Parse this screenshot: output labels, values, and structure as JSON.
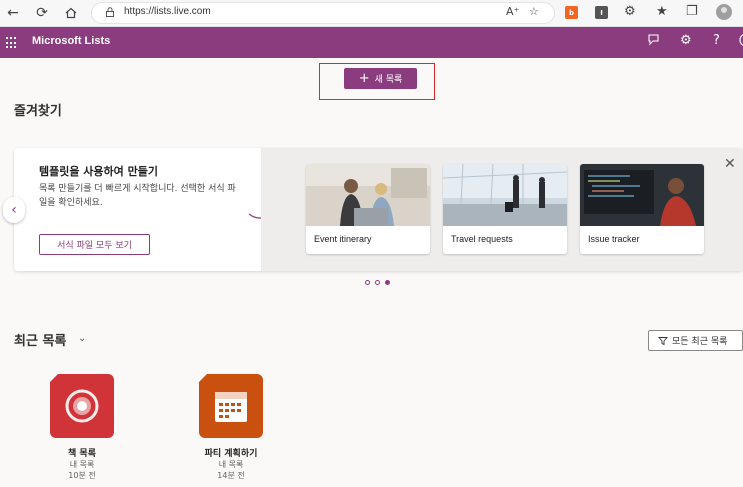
{
  "browser": {
    "url": "https://lists.live.com",
    "extension_colors": [
      "#f26522",
      "#555555"
    ]
  },
  "app": {
    "title": "Microsoft Lists",
    "brand_color": "#8a3c7f"
  },
  "actions": {
    "new_list_label": "새 목록"
  },
  "favorites": {
    "title": "즐겨찾기"
  },
  "templates": {
    "heading": "템플릿을 사용하여 만들기",
    "description": "목록 만들기를 더 빠르게 시작합니다. 선택한 서식 파일을 확인하세요.",
    "view_all_label": "서식 파일 모두 보기",
    "tiles": [
      {
        "label": "Event itinerary"
      },
      {
        "label": "Travel requests"
      },
      {
        "label": "Issue tracker"
      }
    ],
    "pager": {
      "total": 3,
      "active": 3
    }
  },
  "recent": {
    "title": "최근 목록",
    "filter_label": "모든 최근 목록",
    "items": [
      {
        "name": "책 목록",
        "location": "내 목록",
        "time": "10분 전",
        "color": "#d13438",
        "icon": "target-icon"
      },
      {
        "name": "파티 계획하기",
        "location": "내 목록",
        "time": "14분 전",
        "color": "#ca5010",
        "icon": "calendar-icon"
      }
    ]
  }
}
